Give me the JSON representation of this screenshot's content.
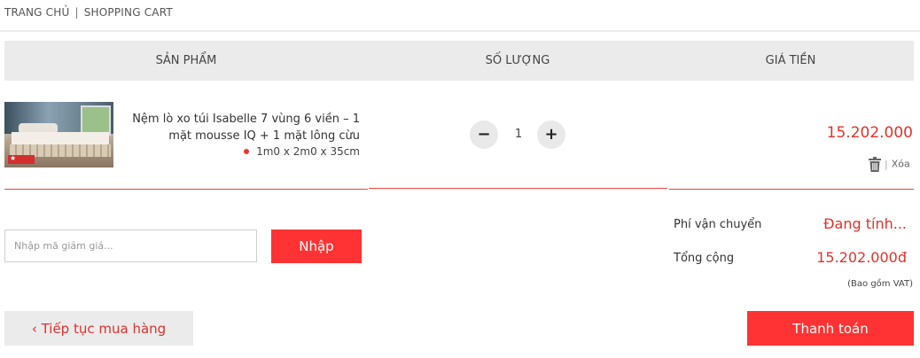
{
  "breadcrumb": {
    "home": "TRANG CHỦ",
    "separator": "|",
    "current": "SHOPPING CART"
  },
  "table_header": {
    "product": "SẢN PHẨM",
    "quantity": "SỐ LƯỢNG",
    "price": "GIÁ TIỀN"
  },
  "item": {
    "name": "Nệm lò xo túi Isabelle 7 vùng 6 viền – 1 mặt mousse IQ + 1 mặt lông cừu",
    "size": "1m0 x 2m0 x 35cm",
    "quantity": "1",
    "minus_icon": "minus-icon",
    "plus_icon": "plus-icon",
    "price": "15.202.000",
    "delete_separator": "|",
    "delete_label": "Xóa",
    "delete_icon": "trash-icon"
  },
  "coupon": {
    "placeholder": "Nhập mã giảm giá...",
    "button": "Nhập"
  },
  "summary": {
    "shipping_label": "Phí vận chuyển",
    "shipping_value": "Đang tính...",
    "total_label": "Tổng cộng",
    "total_value": "15.202.000đ",
    "vat_note": "(Bao gồm VAT)"
  },
  "actions": {
    "continue": "‹ Tiếp tục mua hàng",
    "checkout": "Thanh toán"
  },
  "colors": {
    "accent": "#ff3333",
    "price_red": "#e0322c",
    "header_bg": "#ebebeb"
  }
}
